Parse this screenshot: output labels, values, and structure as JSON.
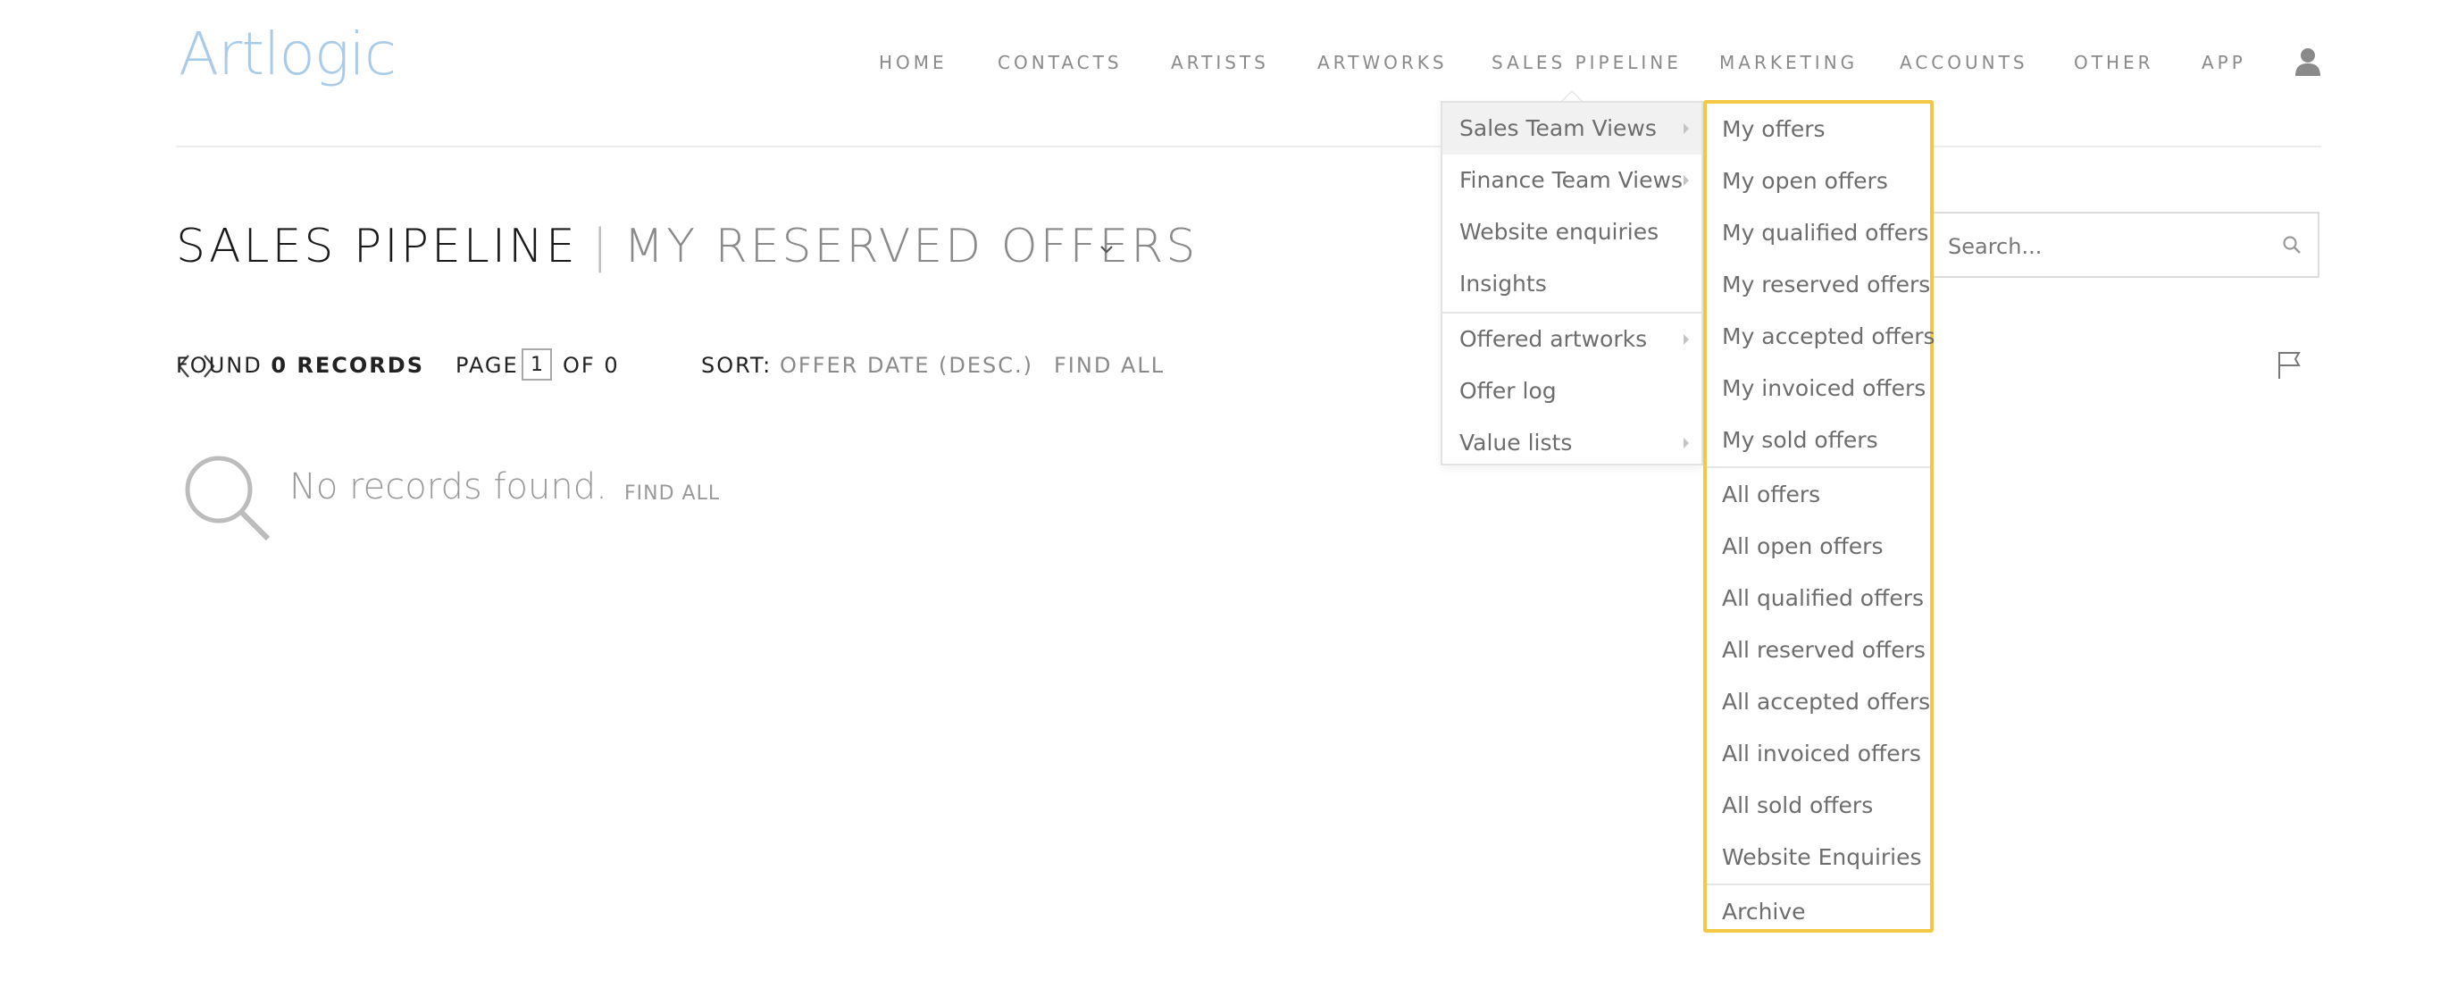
{
  "app": {
    "logo_text": "Artlogic"
  },
  "nav": {
    "items": [
      "HOME",
      "CONTACTS",
      "ARTISTS",
      "ARTWORKS",
      "SALES PIPELINE",
      "MARKETING",
      "ACCOUNTS",
      "OTHER",
      "APP"
    ],
    "active": "SALES PIPELINE",
    "user_icon": "user-icon"
  },
  "page": {
    "title": "SALES PIPELINE",
    "separator": "|",
    "subtitle": "MY RESERVED OFFERS"
  },
  "search": {
    "placeholder": "Search..."
  },
  "toolbar": {
    "found_prefix": "FOUND",
    "found_count": "0 RECORDS",
    "page_label": "PAGE",
    "page_value": "1",
    "of_label": "OF 0",
    "sort_label": "SORT:",
    "sort_value": "OFFER DATE (DESC.)",
    "find_all": "FIND ALL"
  },
  "empty": {
    "message": "No records found.",
    "find_all": "FIND ALL"
  },
  "dropdown": {
    "items": [
      {
        "label": "Sales Team Views",
        "has_submenu": true,
        "active": true
      },
      {
        "label": "Finance Team Views",
        "has_submenu": true
      },
      {
        "label": "Website enquiries"
      },
      {
        "label": "Insights"
      },
      {
        "label": "Offered artworks",
        "has_submenu": true
      },
      {
        "label": "Offer log"
      },
      {
        "label": "Value lists",
        "has_submenu": true
      }
    ],
    "submenu": [
      "My offers",
      "My open offers",
      "My qualified offers",
      "My reserved offers",
      "My accepted offers",
      "My invoiced offers",
      "My sold offers",
      "All offers",
      "All open offers",
      "All qualified offers",
      "All reserved offers",
      "All accepted offers",
      "All invoiced offers",
      "All sold offers",
      "Website Enquiries",
      "Archive"
    ]
  },
  "colors": {
    "logo": "#a9cbe8",
    "highlight_border": "#f2c744",
    "nav_text": "#8a8a8a"
  }
}
